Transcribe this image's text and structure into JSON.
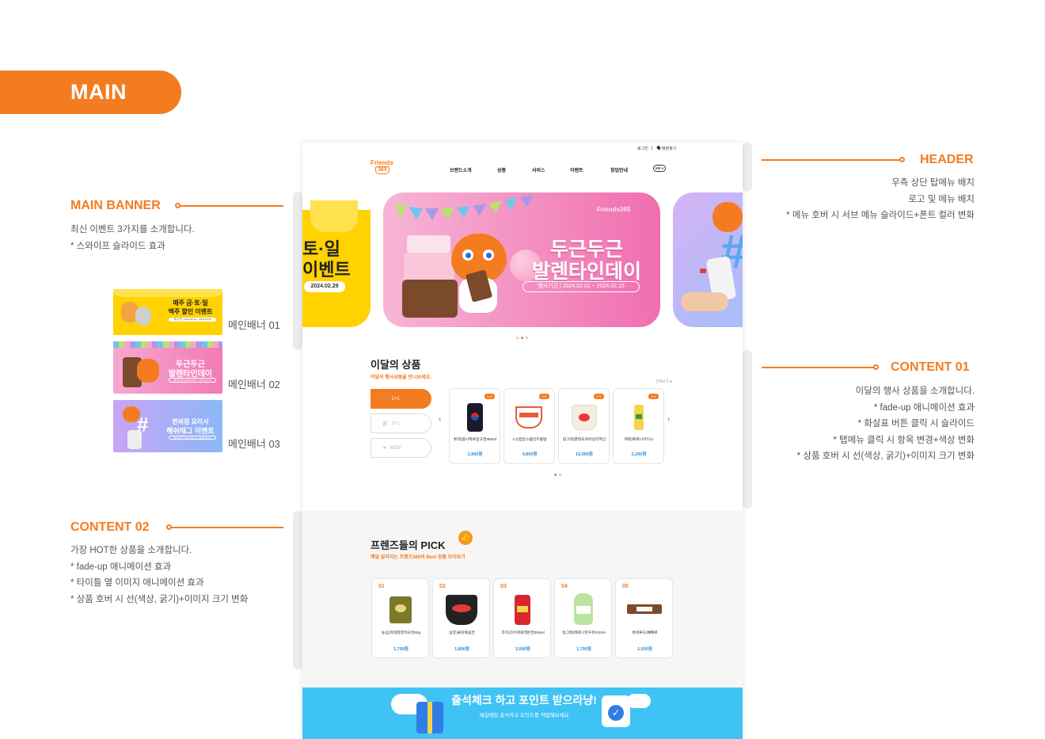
{
  "section_label": "MAIN",
  "annotations": {
    "main_banner": {
      "title": "MAIN BANNER",
      "lines": [
        "최신 이벤트 3가지를 소개합니다.",
        "* 스와이프 슬라이드 효과"
      ]
    },
    "header": {
      "title": "HEADER",
      "lines": [
        "우측 상단 탑메뉴 배치",
        "로고 및 메뉴 배치",
        "* 메뉴 호버 시 서브 메뉴 슬라이드+폰트 컬러 변화"
      ]
    },
    "content01": {
      "title": "CONTENT 01",
      "lines": [
        "이달의 행사 상품을 소개합니다.",
        "* fade-up 애니메이션 효과",
        "* 화살표 버튼 클릭 시 슬라이드",
        "* 탭메뉴 클릭 시 항목 변경+색상 변화",
        "* 상품 호버 시 선(색상, 굵기)+이미지 크기 변화"
      ]
    },
    "content02": {
      "title": "CONTENT 02",
      "lines": [
        "가장 HOT한 상품을 소개합니다.",
        "* fade-up 애니메이션 효과",
        "* 타이틀 옆 이미지 애니메이션 효과",
        "* 상품 호버 시 선(색상, 굵기)+이미지 크기 변화"
      ]
    }
  },
  "thumbnails": [
    {
      "label": "메인배너 01",
      "text1": "매주 금·토·일",
      "text2": "맥주 할인 이벤트",
      "date": "행사기간 | 2024.02.01 ~ 2024.02.29"
    },
    {
      "label": "메인배너 02",
      "text1": "두근두근",
      "text2": "발렌타인데이",
      "date": "행사기간 | 2024.02.01 ~ 2024.02.15"
    },
    {
      "label": "메인배너 03",
      "text1": "편의점 요리사",
      "text2": "해쉬태그 이벤트",
      "date": "행사기간 | 2024.02.01 ~ 2024.02.29"
    }
  ],
  "mockup": {
    "top_links": {
      "login": "로그인",
      "store": "매장찾기"
    },
    "logo": {
      "line1": "Friends",
      "line2": "365"
    },
    "nav": [
      "브랜드소개",
      "상품",
      "서비스",
      "이벤트",
      "창업안내"
    ],
    "lang": "KR",
    "banner_left": {
      "text1": "토·일",
      "text2": "이벤트",
      "date": "2024.02.29"
    },
    "banner_main": {
      "brand": "Friends365",
      "title1": "두근두근",
      "title2": "발렌타인데이",
      "date": "행사기간  |  2024.02.01 ~ 2024.02.15"
    },
    "content01": {
      "title": "이달의 상품",
      "subtitle": "이달의 행사상품을 만나보세요.",
      "more": "전체보기",
      "tabs": [
        "1+1",
        "2+1",
        "NEW"
      ],
      "products": [
        {
          "badge": "1+1",
          "name": "롯데)펩시제로망고캔355ml",
          "price": "1,900원",
          "color": "#1a1a2e"
        },
        {
          "badge": "1+1",
          "name": "CJ)컵반스팸김치덮밥",
          "price": "4,800원",
          "color": "#e35d3a"
        },
        {
          "badge": "1+1",
          "name": "빙그레)끌레도르바닐라파인",
          "price": "12,900원",
          "color": "#f2e0c9"
        },
        {
          "badge": "1+1",
          "name": "해태)메로나아이스",
          "price": "2,200원",
          "color": "#f5d34a"
        }
      ]
    },
    "content02": {
      "title": "프렌즈들의 PICK",
      "subtitle": "매일 달라지는 프렌즈365의 Best 상품 모아보기",
      "products": [
        {
          "rank": "01",
          "name": "농심)먹태청양마요맛60g",
          "price": "1,700원",
          "color": "#7a7a2a"
        },
        {
          "rank": "02",
          "name": "삼양)불닭볶음면",
          "price": "1,800원",
          "color": "#222222"
        },
        {
          "rank": "03",
          "name": "코카)코카제로레몬캔355ml",
          "price": "2,000원",
          "color": "#d8262e"
        },
        {
          "rank": "04",
          "name": "빙그레)메로나맛우유240ml",
          "price": "1,700원",
          "color": "#bde3a2"
        },
        {
          "rank": "05",
          "name": "롯데푸드)빼빼로",
          "price": "1,500원",
          "color": "#7b4a2b"
        }
      ]
    },
    "footer_banner": {
      "title": "출석체크 하고 포인트 받으라냥!",
      "subtitle": "매일매일 출석하고 포인트를 적립해보세요"
    }
  },
  "colors": {
    "accent": "#f47c20",
    "price_blue": "#2a8bd6",
    "sky": "#3fc3f5",
    "banner_pink": "#f07eb7"
  }
}
